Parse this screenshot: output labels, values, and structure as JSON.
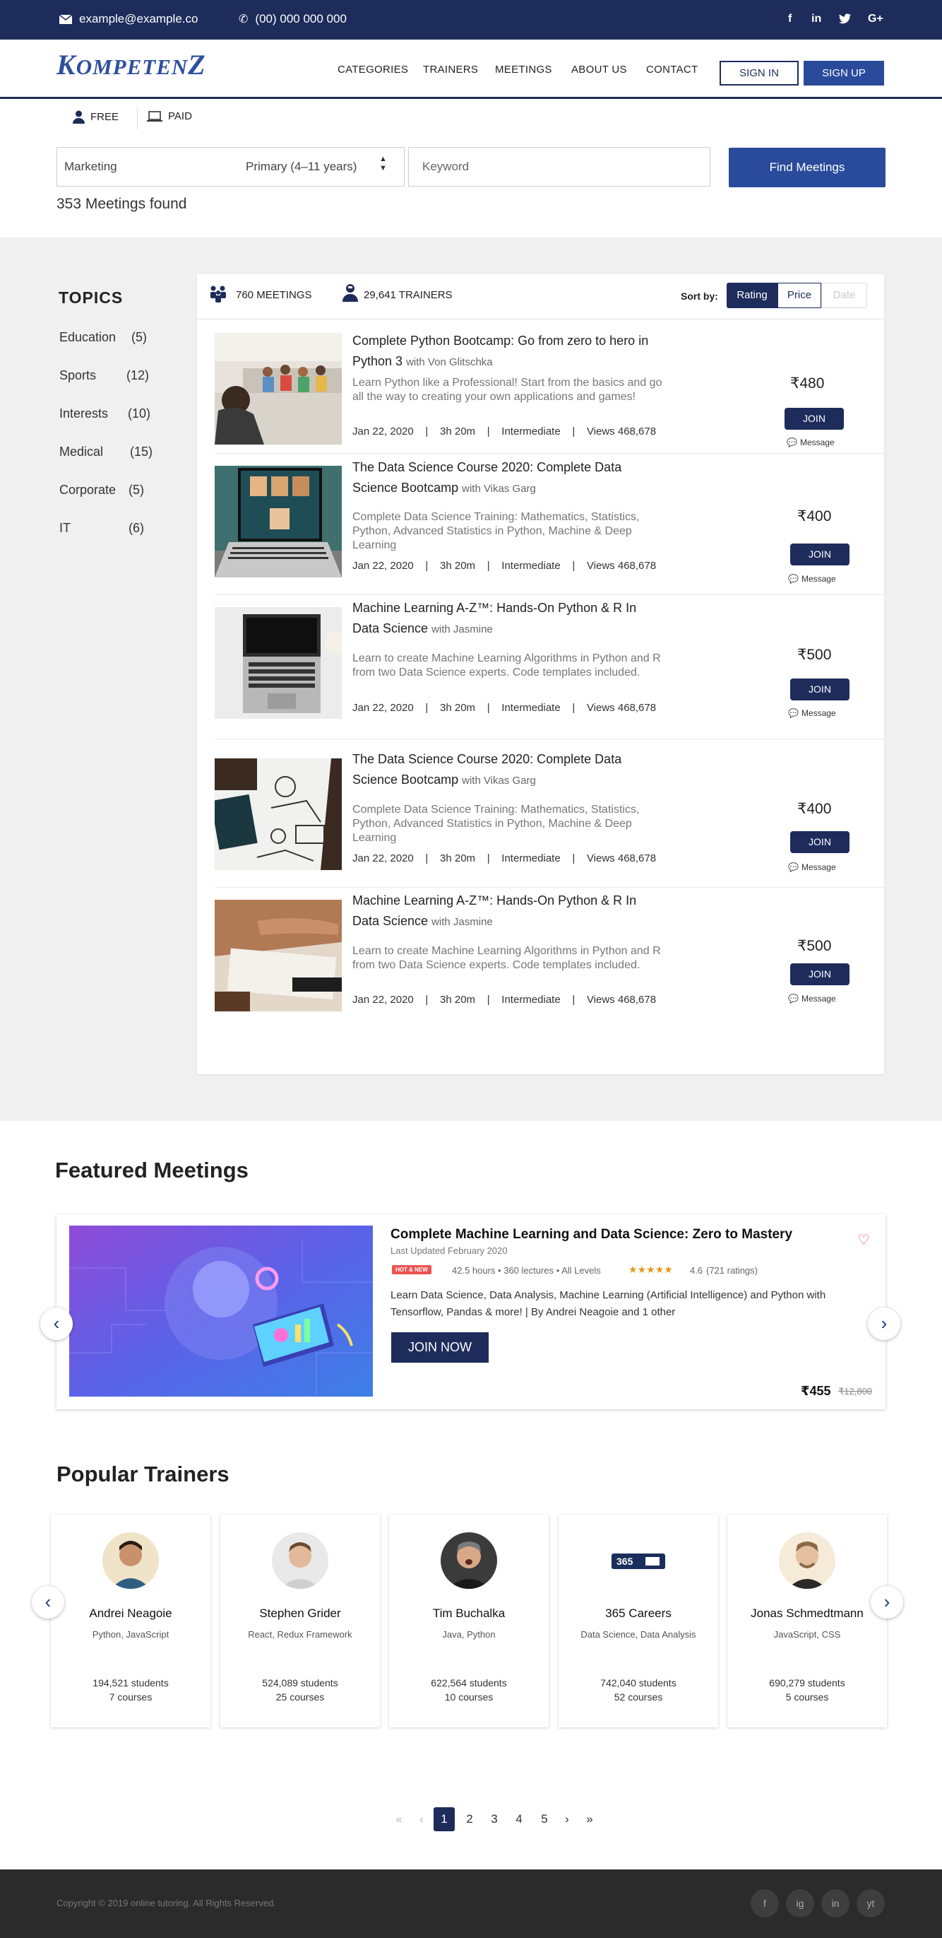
{
  "topbar": {
    "email": "example@example.co",
    "phone": "(00) 000 000 000",
    "social": [
      "f",
      "in",
      "t",
      "G+"
    ]
  },
  "nav": {
    "logo_k": "K",
    "logo_rest": "OMPETEN",
    "logo_z": "Z",
    "items": [
      "CATEGORIES",
      "TRAINERS",
      "MEETINGS",
      "ABOUT US",
      "CONTACT"
    ],
    "sign_in": "SIGN IN",
    "sign_up": "SIGN UP"
  },
  "search": {
    "tab_free": "FREE",
    "tab_paid": "PAID",
    "category": "Marketing",
    "level": "Primary (4–11 years)",
    "keyword_placeholder": "Keyword",
    "find_label": "Find Meetings",
    "found": "353 Meetings found"
  },
  "topics": {
    "title": "TOPICS",
    "items": [
      {
        "name": "Education",
        "count": "(5)"
      },
      {
        "name": "Sports",
        "count": "(12)"
      },
      {
        "name": "Interests",
        "count": "(10)"
      },
      {
        "name": "Medical",
        "count": "(15)"
      },
      {
        "name": "Corporate",
        "count": "(5)"
      },
      {
        "name": "IT",
        "count": "(6)"
      }
    ]
  },
  "results": {
    "meetings": "760 MEETINGS",
    "trainers": "29,641 TRAINERS",
    "sort_label": "Sort by:",
    "sort_options": [
      "Rating",
      "Price",
      "Date"
    ],
    "join_label": "JOIN",
    "message_label": "Message",
    "courses": [
      {
        "title": "Complete Python Bootcamp: Go from zero to hero in Python 3",
        "with": "with  Von Glitschka",
        "desc": "Learn Python like a Professional! Start from the basics and go all the way to creating your own applications and games!",
        "date": "Jan 22, 2020",
        "duration": "3h 20m",
        "level": "Intermediate",
        "views": "Views 468,678",
        "price": "₹480"
      },
      {
        "title": "The Data Science Course 2020: Complete Data Science Bootcamp",
        "with": "with  Vikas Garg",
        "desc": "Complete Data Science Training: Mathematics, Statistics, Python, Advanced Statistics in Python, Machine & Deep Learning",
        "date": "Jan 22, 2020",
        "duration": "3h 20m",
        "level": "Intermediate",
        "views": "Views 468,678",
        "price": "₹400"
      },
      {
        "title": "Machine Learning A-Z™: Hands-On Python & R In Data Science",
        "with": "with  Jasmine",
        "desc": "Learn to create Machine Learning Algorithms in Python and R from two Data Science experts. Code templates included.",
        "date": "Jan 22, 2020",
        "duration": "3h 20m",
        "level": "Intermediate",
        "views": "Views 468,678",
        "price": "₹500"
      },
      {
        "title": "The Data Science Course 2020: Complete Data Science Bootcamp",
        "with": "with  Vikas Garg",
        "desc": "Complete Data Science Training: Mathematics, Statistics, Python, Advanced Statistics in Python, Machine & Deep Learning",
        "date": "Jan 22, 2020",
        "duration": "3h 20m",
        "level": "Intermediate",
        "views": "Views 468,678",
        "price": "₹400"
      },
      {
        "title": "Machine Learning A-Z™: Hands-On Python & R In Data Science",
        "with": "with  Jasmine",
        "desc": "Learn to create Machine Learning Algorithms in Python and R from two Data Science experts. Code templates included.",
        "date": "Jan 22, 2020",
        "duration": "3h 20m",
        "level": "Intermediate",
        "views": "Views 468,678",
        "price": "₹500"
      }
    ]
  },
  "featured": {
    "section_title": "Featured Meetings",
    "title": "Complete Machine Learning and Data Science: Zero to Mastery",
    "updated": "Last Updated February 2020",
    "badge": "HOT & NEW",
    "stats": "42.5 hours • 360 lectures • All Levels",
    "rating": "4.6",
    "ratings_count": "(721 ratings)",
    "rating_value": 4.6,
    "desc": "Learn Data Science, Data Analysis, Machine Learning (Artificial Intelligence) and Python with Tensorflow, Pandas & more! | By Andrei Neagoie and 1 other",
    "cta": "JOIN NOW",
    "price": "₹455",
    "old_price": "₹12,800"
  },
  "trainers": {
    "section_title": "Popular Trainers",
    "items": [
      {
        "name": "Andrei Neagoie",
        "skills": "Python, JavaScript",
        "students": "194,521 students",
        "courses": "7 courses"
      },
      {
        "name": "Stephen Grider",
        "skills": "React, Redux Framework",
        "students": "524,089 students",
        "courses": "25 courses"
      },
      {
        "name": "Tim Buchalka",
        "skills": "Java, Python",
        "students": "622,564 students",
        "courses": "10 courses"
      },
      {
        "name": "365 Careers",
        "skills": "Data Science, Data Analysis",
        "students": "742,040 students",
        "courses": "52 courses"
      },
      {
        "name": "Jonas Schmedtmann",
        "skills": "JavaScript, CSS",
        "students": "690,279 students",
        "courses": "5 courses"
      }
    ],
    "logo_365": "365"
  },
  "pagination": {
    "first": "«",
    "prev": "‹",
    "pages": [
      "1",
      "2",
      "3",
      "4",
      "5"
    ],
    "next": "›",
    "last": "»",
    "current": "1"
  },
  "footer": {
    "copyright": "Copyright © 2019 online tutoring. All Rights Reserved.",
    "social": [
      "f",
      "ig",
      "in",
      "yt"
    ]
  }
}
